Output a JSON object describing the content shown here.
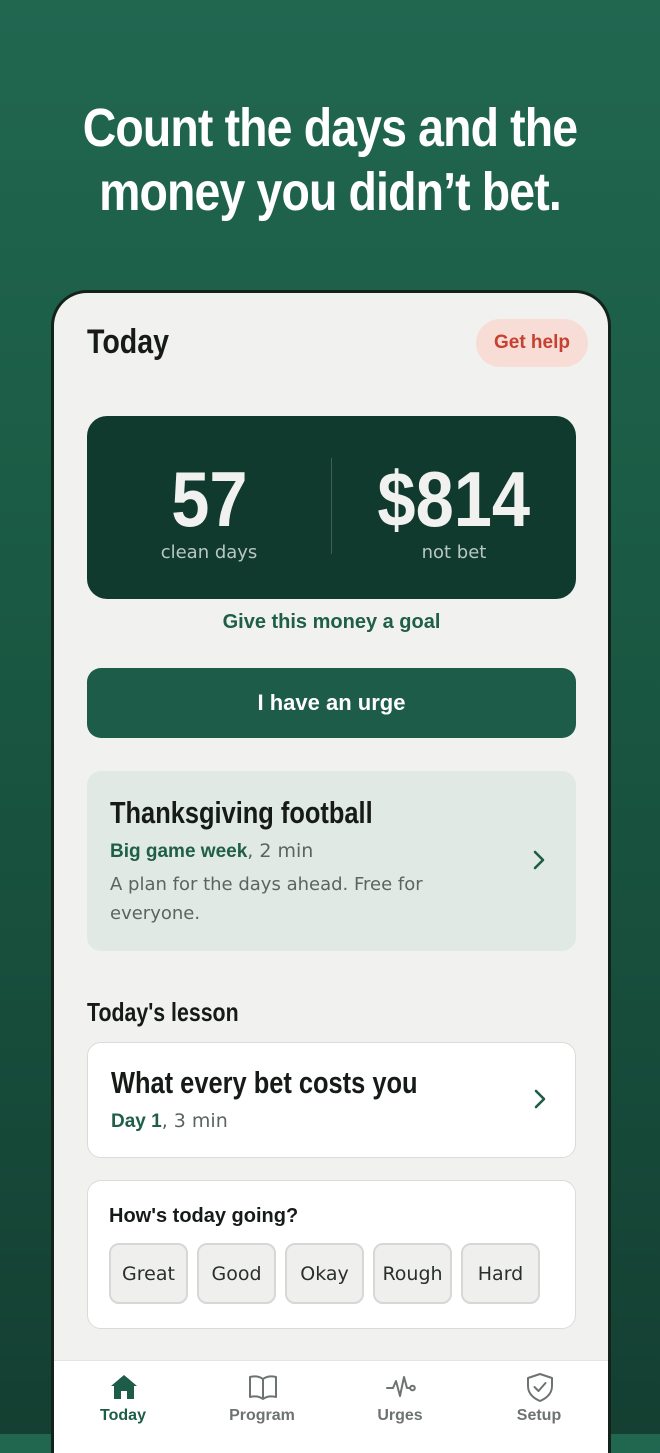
{
  "headline": {
    "line1": "Count the days and the",
    "line2": "money you didn’t bet."
  },
  "screen": {
    "title": "Today",
    "help_label": "Get help",
    "stats": {
      "days_value": "57",
      "days_label": "clean days",
      "money_value": "$814",
      "money_label": "not bet"
    },
    "goal_link": "Give this money a goal",
    "urge_button": "I have an urge",
    "promo": {
      "title": "Thanksgiving football",
      "meta_bold": "Big game week",
      "meta_rest": ", 2 min",
      "description": "A plan for the days ahead. Free for everyone."
    },
    "lesson_section": "Today's lesson",
    "lesson": {
      "title": "What every bet costs you",
      "meta_bold": "Day 1",
      "meta_rest": ", 3 min"
    },
    "mood": {
      "question": "How's today going?",
      "options": [
        "Great",
        "Good",
        "Okay",
        "Rough",
        "Hard"
      ]
    },
    "tabs": [
      {
        "label": "Today",
        "icon": "home-icon",
        "active": true
      },
      {
        "label": "Program",
        "icon": "book-icon",
        "active": false
      },
      {
        "label": "Urges",
        "icon": "pulse-icon",
        "active": false
      },
      {
        "label": "Setup",
        "icon": "shield-check-icon",
        "active": false
      }
    ]
  },
  "colors": {
    "background": "#1f614c",
    "brand_green": "#1d5c48",
    "stats_card": "#113a2f",
    "help_bg": "#f8dcd6",
    "help_text": "#c4422f",
    "screen_bg": "#f1f2ef"
  }
}
